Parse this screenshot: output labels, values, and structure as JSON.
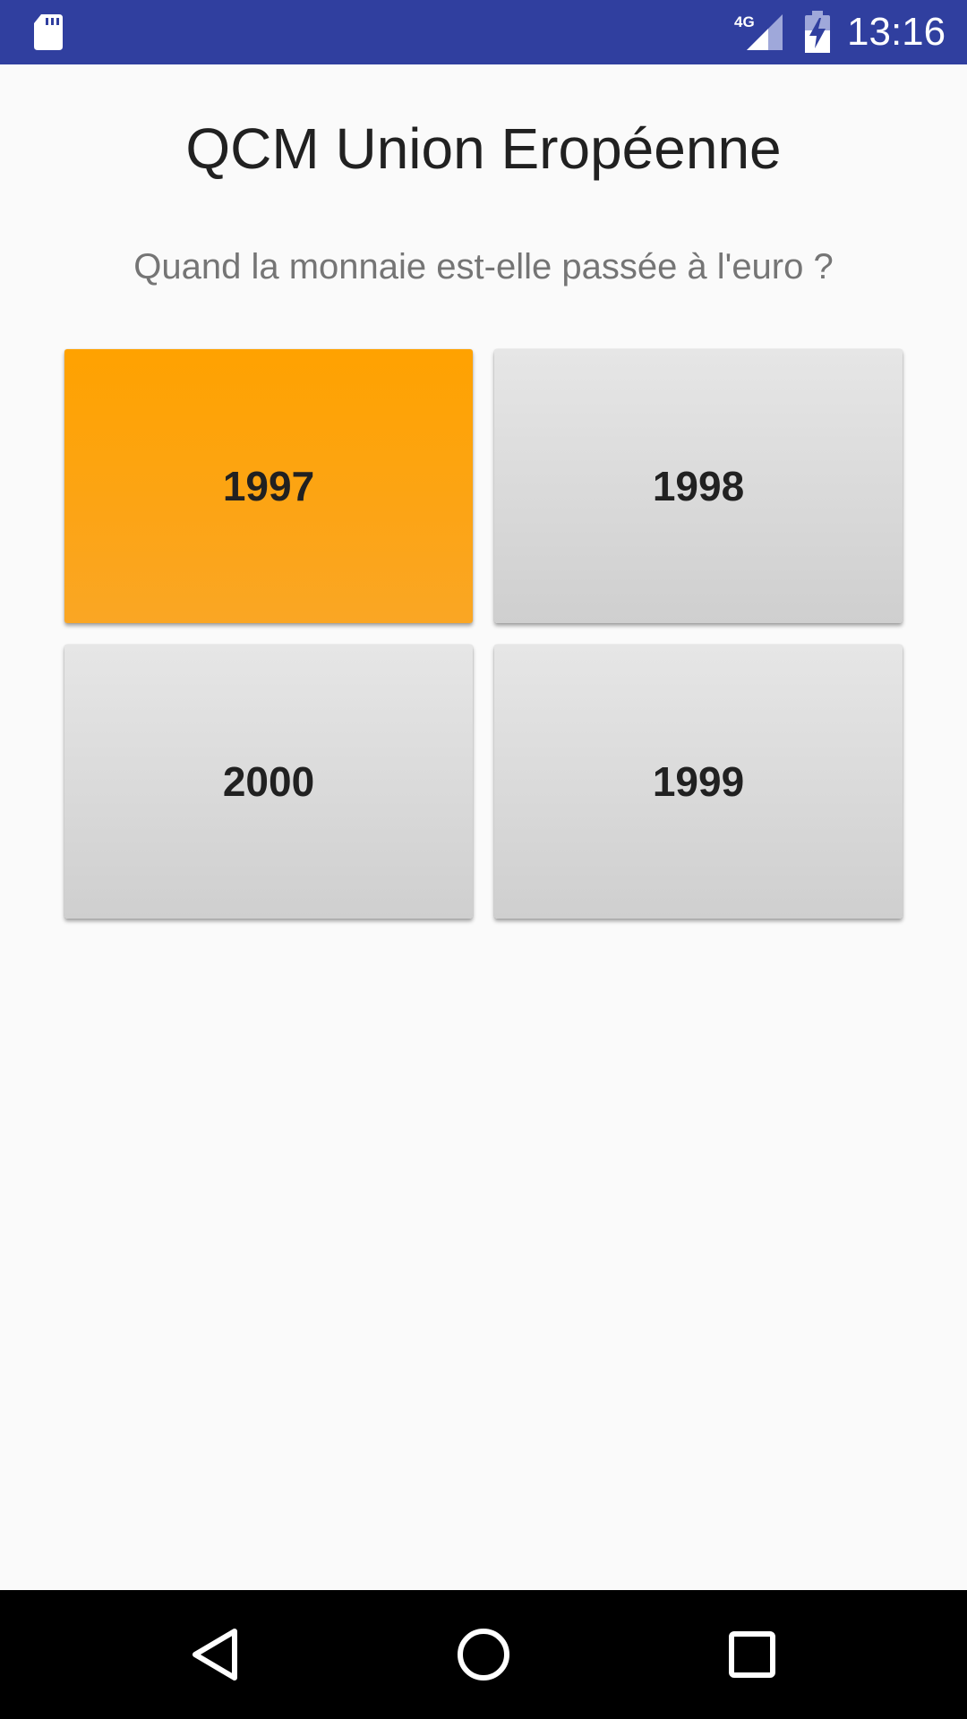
{
  "status_bar": {
    "time": "13:16",
    "network_label": "4G",
    "background_color": "#303f9f",
    "icons": [
      "sd-card-icon",
      "signal-4g-icon",
      "battery-charging-icon"
    ]
  },
  "app": {
    "title": "QCM Union Eropéenne",
    "question": "Quand la monnaie est-elle passée à l'euro ?"
  },
  "answers": [
    {
      "label": "1997",
      "selected": true,
      "color": "#ffa200"
    },
    {
      "label": "1998",
      "selected": false
    },
    {
      "label": "2000",
      "selected": false
    },
    {
      "label": "1999",
      "selected": false
    }
  ],
  "nav_bar": {
    "icons": [
      "back-icon",
      "home-icon",
      "recents-icon"
    ]
  }
}
